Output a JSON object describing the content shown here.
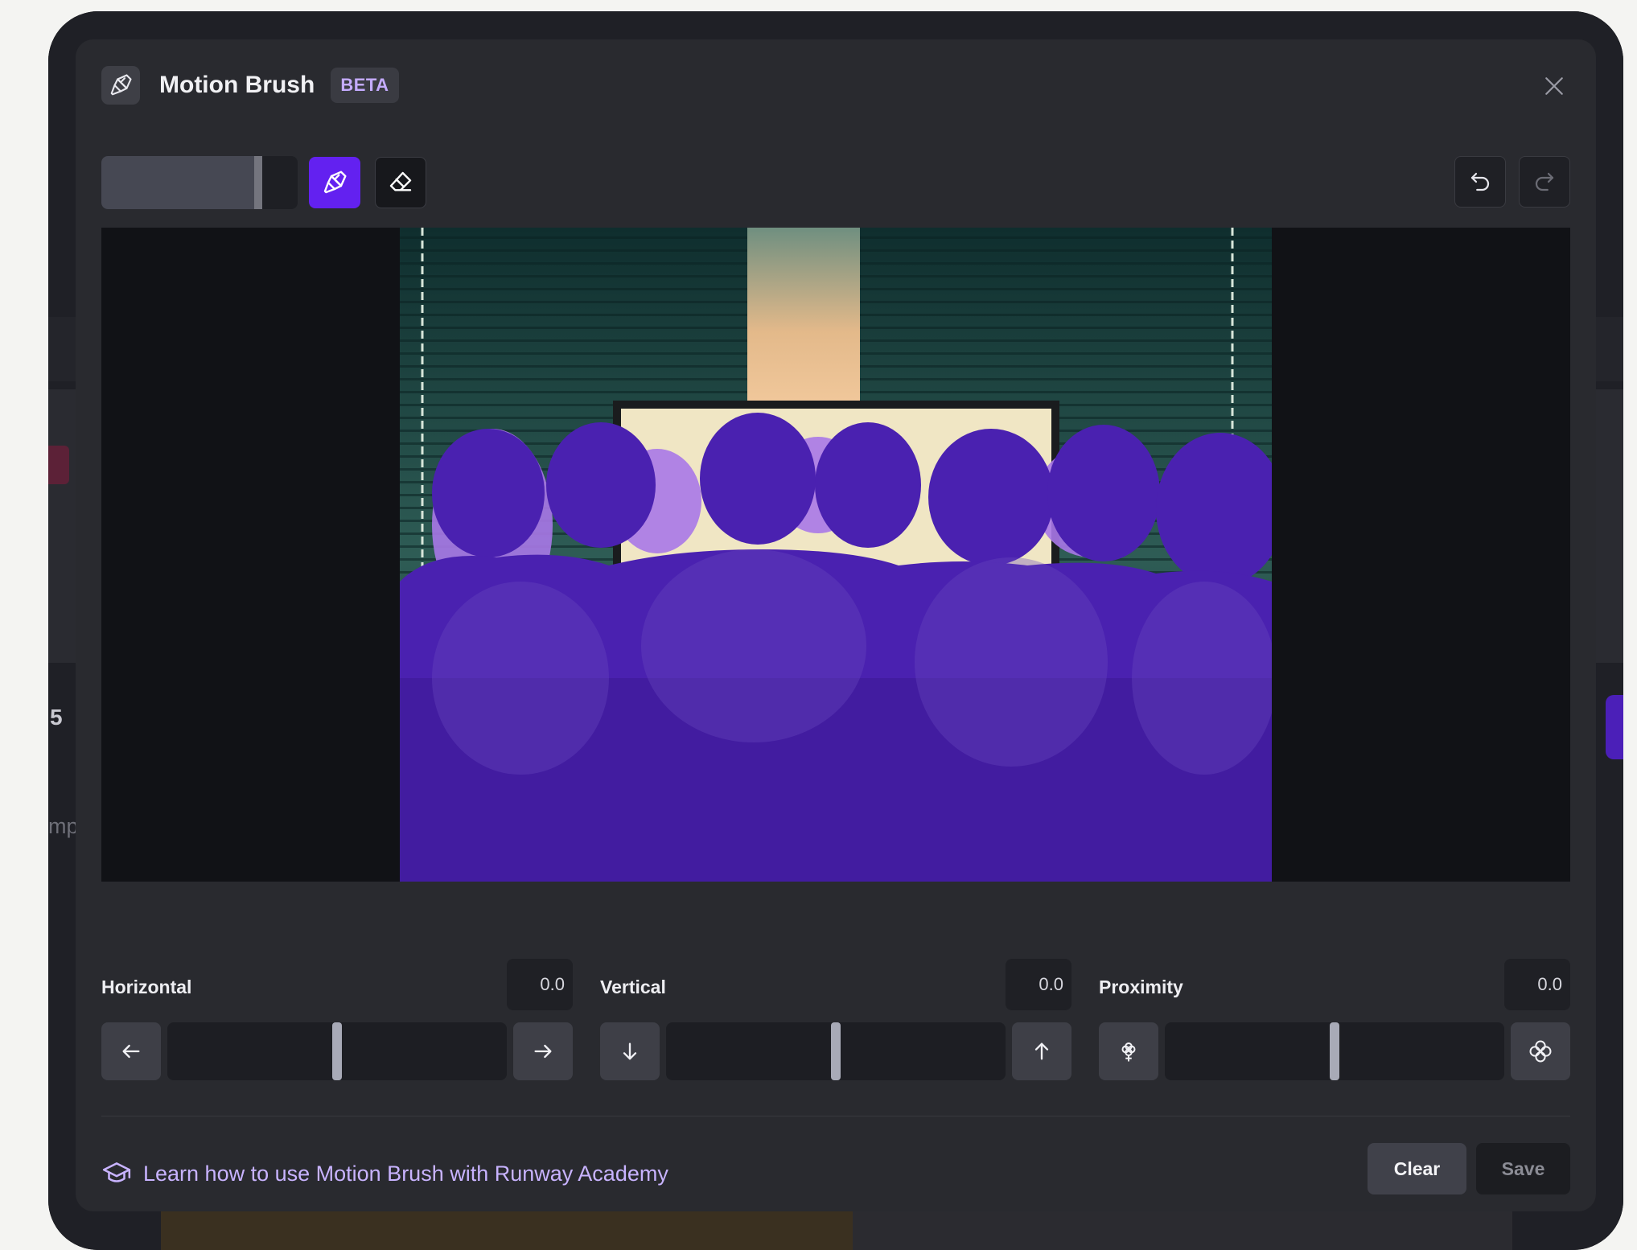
{
  "underlay": {
    "number": "5",
    "partial_text": "mp"
  },
  "modal": {
    "title": "Motion Brush",
    "badge": "BETA",
    "header_icon": "brush-icon",
    "close_icon": "close-icon"
  },
  "toolbar": {
    "brush_size": 0.82,
    "brush_icon": "brush-icon",
    "eraser_icon": "eraser-icon",
    "undo_icon": "undo-icon",
    "redo_icon": "redo-icon",
    "active_tool": "brush"
  },
  "colors": {
    "accent": "#6321f0",
    "mask": "#5b24c9",
    "link": "#c8b3ff"
  },
  "controls": [
    {
      "label": "Horizontal",
      "value": "0.0",
      "level": 0.5,
      "left_icon": "arrow-left-icon",
      "right_icon": "arrow-right-icon"
    },
    {
      "label": "Vertical",
      "value": "0.0",
      "level": 0.5,
      "left_icon": "arrow-down-icon",
      "right_icon": "arrow-up-icon"
    },
    {
      "label": "Proximity",
      "value": "0.0",
      "level": 0.5,
      "left_icon": "flower-small-icon",
      "right_icon": "flower-large-icon"
    }
  ],
  "footer": {
    "link_icon": "graduation-cap-icon",
    "link_text": "Learn how to use Motion Brush with Runway Academy",
    "clear_label": "Clear",
    "save_label": "Save"
  }
}
